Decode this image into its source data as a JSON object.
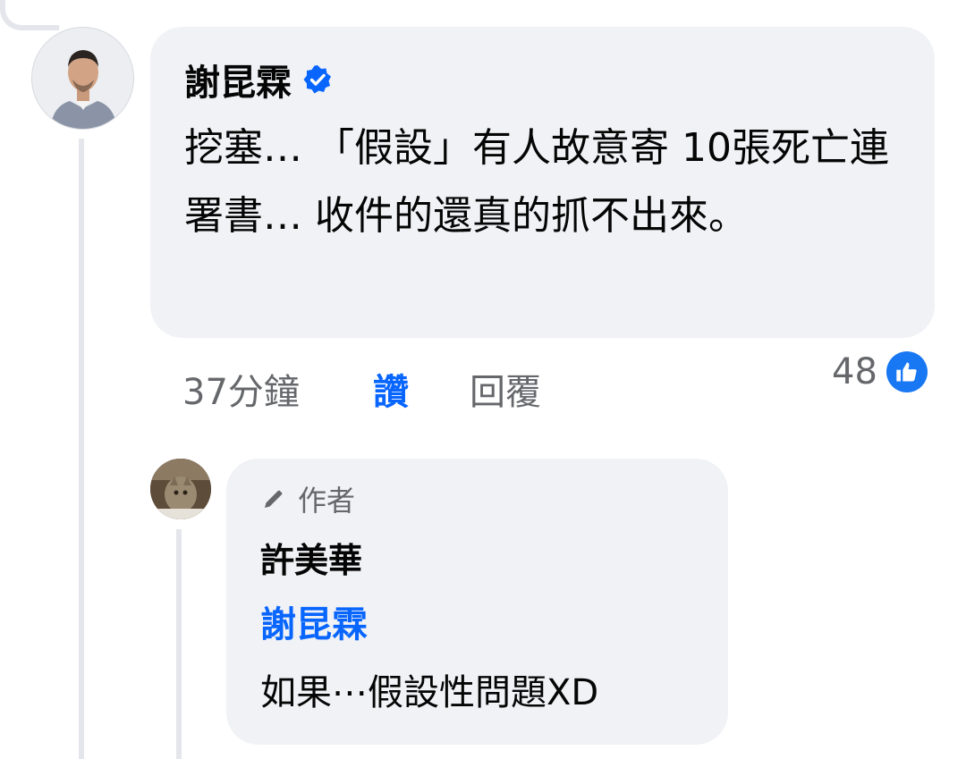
{
  "comment": {
    "author": "謝昆霖",
    "verified": true,
    "text": "挖塞… 「假設」有人故意寄 10張死亡連署書… 收件的還真的抓不出來。",
    "time": "37分鐘",
    "like_label": "讚",
    "reply_label": "回覆",
    "reaction_count": "48",
    "reaction_icon": "thumbs-up-icon"
  },
  "reply": {
    "badge_label": "作者",
    "badge_icon": "pencil-icon",
    "author": "許美華",
    "mention": "謝昆霖",
    "text": "如果⋯假設性問題XD"
  },
  "colors": {
    "bubble_bg": "#f0f2f5",
    "link_blue": "#0866ff",
    "meta_gray": "#65676b",
    "thread_line": "#e4e6eb",
    "like_blue": "#1877f2"
  }
}
